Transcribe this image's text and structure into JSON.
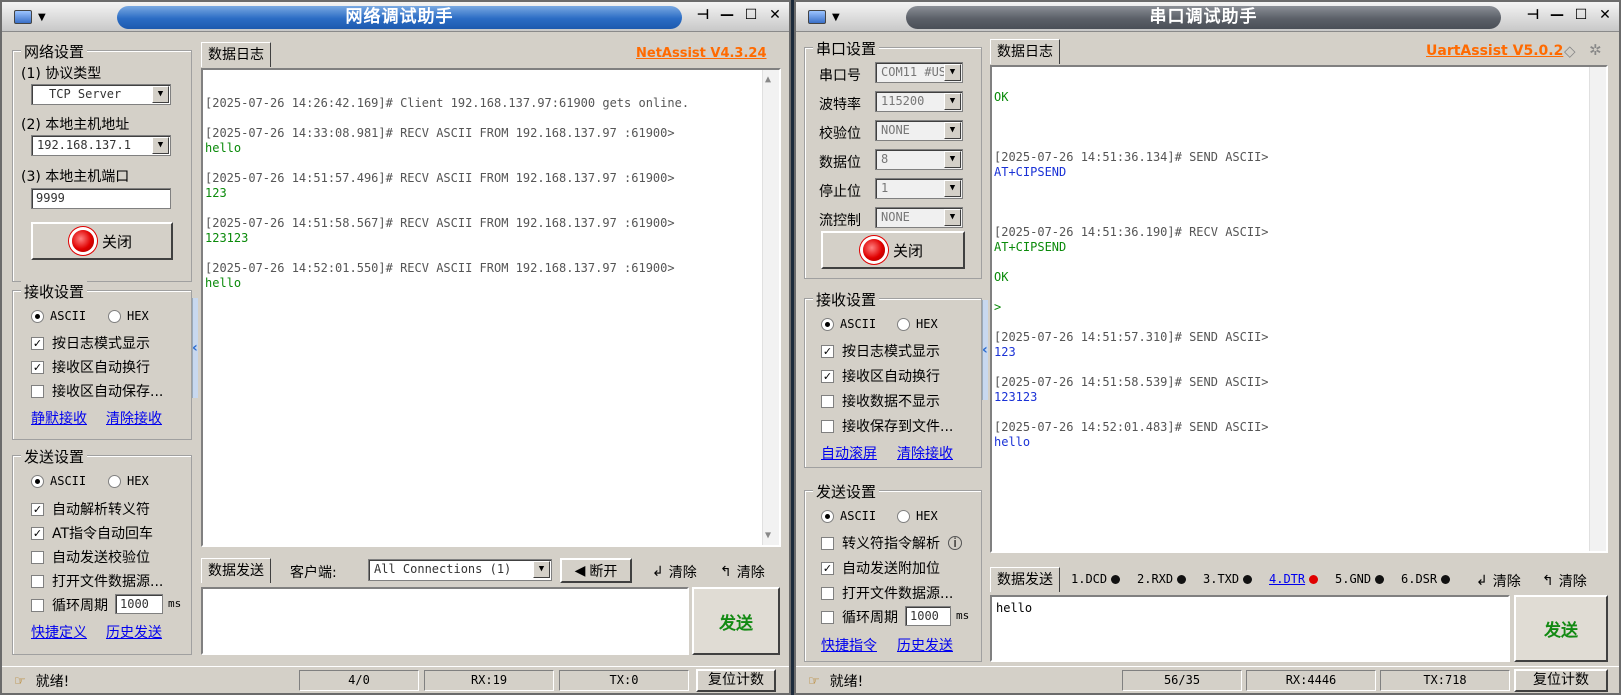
{
  "net": {
    "title": "网络调试助手",
    "brand": "NetAssist V4.3.24",
    "settings": {
      "group_title": "网络设置",
      "protocol_label": "(1) 协议类型",
      "protocol_value": "TCP Server",
      "host_label": "(2) 本地主机地址",
      "host_value": "192.168.137.1",
      "port_label": "(3) 本地主机端口",
      "port_value": "9999",
      "close_button": "关闭"
    },
    "recv": {
      "group_title": "接收设置",
      "ascii": "ASCII",
      "hex": "HEX",
      "opt1": "按日志模式显示",
      "opt2": "接收区自动换行",
      "opt3": "接收区自动保存...",
      "link1": "静默接收",
      "link2": "清除接收"
    },
    "send": {
      "group_title": "发送设置",
      "ascii": "ASCII",
      "hex": "HEX",
      "opt1": "自动解析转义符",
      "opt2": "AT指令自动回车",
      "opt3": "自动发送校验位",
      "opt4": "打开文件数据源...",
      "opt5": "循环周期",
      "period": "1000",
      "unit": "ms",
      "link1": "快捷定义",
      "link2": "历史发送"
    },
    "log_tab": "数据日志",
    "log": [
      {
        "t": "[2025-07-26 14:26:42.169]# Client 192.168.137.97:61900 gets online.",
        "c": "hdr"
      },
      {
        "t": "",
        "c": "hdr"
      },
      {
        "t": "[2025-07-26 14:33:08.981]# RECV ASCII FROM 192.168.137.97 :61900>",
        "c": "hdr"
      },
      {
        "t": "hello",
        "c": "g"
      },
      {
        "t": "",
        "c": "hdr"
      },
      {
        "t": "[2025-07-26 14:51:57.496]# RECV ASCII FROM 192.168.137.97 :61900>",
        "c": "hdr"
      },
      {
        "t": "123",
        "c": "g"
      },
      {
        "t": "",
        "c": "hdr"
      },
      {
        "t": "[2025-07-26 14:51:58.567]# RECV ASCII FROM 192.168.137.97 :61900>",
        "c": "hdr"
      },
      {
        "t": "123123",
        "c": "g"
      },
      {
        "t": "",
        "c": "hdr"
      },
      {
        "t": "[2025-07-26 14:52:01.550]# RECV ASCII FROM 192.168.137.97 :61900>",
        "c": "hdr"
      },
      {
        "t": "hello",
        "c": "g"
      }
    ],
    "send_tab": "数据发送",
    "client_label": "客户端:",
    "client_value": "All Connections (1)",
    "disconnect": "断开",
    "clear1": "清除",
    "clear2": "清除",
    "send_text": "",
    "send_button": "发送",
    "status": {
      "ready": "就绪!",
      "count": "4/0",
      "rx": "RX:19",
      "tx": "TX:0",
      "reset": "复位计数"
    }
  },
  "uart": {
    "title": "串口调试助手",
    "brand": "UartAssist V5.0.2",
    "settings": {
      "group_title": "串口设置",
      "port_label": "串口号",
      "port_value": "COM11 #US",
      "baud_label": "波特率",
      "baud_value": "115200",
      "parity_label": "校验位",
      "parity_value": "NONE",
      "data_label": "数据位",
      "data_value": "8",
      "stop_label": "停止位",
      "stop_value": "1",
      "flow_label": "流控制",
      "flow_value": "NONE",
      "close_button": "关闭"
    },
    "recv": {
      "group_title": "接收设置",
      "ascii": "ASCII",
      "hex": "HEX",
      "opt1": "按日志模式显示",
      "opt2": "接收区自动换行",
      "opt3": "接收数据不显示",
      "opt4": "接收保存到文件...",
      "link1": "自动滚屏",
      "link2": "清除接收"
    },
    "send": {
      "group_title": "发送设置",
      "ascii": "ASCII",
      "hex": "HEX",
      "opt1": "转义符指令解析",
      "opt2": "自动发送附加位",
      "opt3": "打开文件数据源...",
      "opt4": "循环周期",
      "period": "1000",
      "unit": "ms",
      "link1": "快捷指令",
      "link2": "历史发送"
    },
    "log_tab": "数据日志",
    "log": [
      {
        "t": "OK",
        "c": "g"
      },
      {
        "t": "",
        "c": "hdr"
      },
      {
        "t": "",
        "c": "hdr"
      },
      {
        "t": "",
        "c": "hdr"
      },
      {
        "t": "[2025-07-26 14:51:36.134]# SEND ASCII>",
        "c": "hdr"
      },
      {
        "t": "AT+CIPSEND",
        "c": "b"
      },
      {
        "t": "",
        "c": "hdr"
      },
      {
        "t": "",
        "c": "hdr"
      },
      {
        "t": "",
        "c": "hdr"
      },
      {
        "t": "[2025-07-26 14:51:36.190]# RECV ASCII>",
        "c": "hdr"
      },
      {
        "t": "AT+CIPSEND",
        "c": "g"
      },
      {
        "t": "",
        "c": "hdr"
      },
      {
        "t": "OK",
        "c": "g"
      },
      {
        "t": "",
        "c": "hdr"
      },
      {
        "t": ">",
        "c": "g"
      },
      {
        "t": "",
        "c": "hdr"
      },
      {
        "t": "[2025-07-26 14:51:57.310]# SEND ASCII>",
        "c": "hdr"
      },
      {
        "t": "123",
        "c": "b"
      },
      {
        "t": "",
        "c": "hdr"
      },
      {
        "t": "[2025-07-26 14:51:58.539]# SEND ASCII>",
        "c": "hdr"
      },
      {
        "t": "123123",
        "c": "b"
      },
      {
        "t": "",
        "c": "hdr"
      },
      {
        "t": "[2025-07-26 14:52:01.483]# SEND ASCII>",
        "c": "hdr"
      },
      {
        "t": "hello",
        "c": "b"
      }
    ],
    "send_tab": "数据发送",
    "pins": [
      "1.DCD",
      "2.RXD",
      "3.TXD",
      "4.DTR",
      "5.GND",
      "6.DSR"
    ],
    "clear1": "清除",
    "clear2": "清除",
    "send_text": "hello",
    "send_button": "发送",
    "status": {
      "ready": "就绪!",
      "count": "56/35",
      "rx": "RX:4446",
      "tx": "TX:718",
      "reset": "复位计数"
    }
  }
}
